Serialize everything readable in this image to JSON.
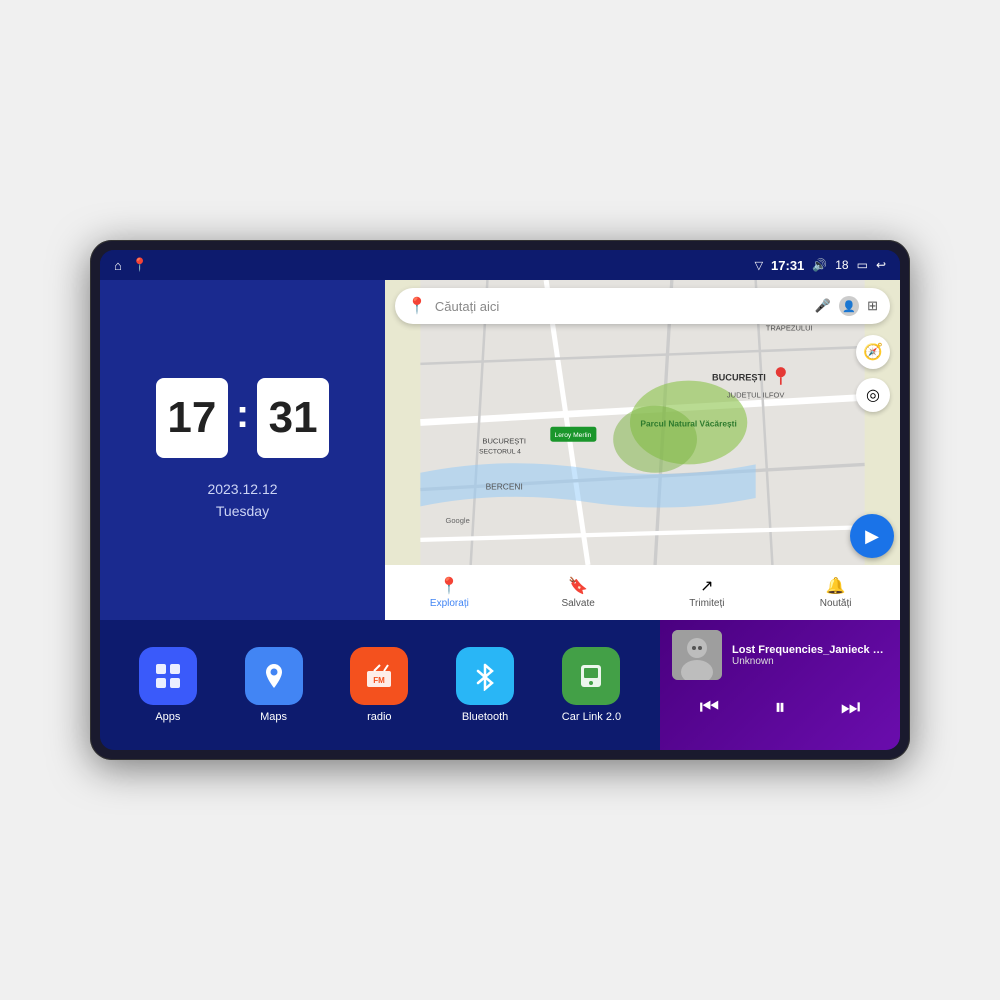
{
  "device": {
    "status_bar": {
      "left_icons": [
        "home",
        "maps"
      ],
      "time": "17:31",
      "signal_icon": "▽",
      "volume_icon": "🔊",
      "volume_level": "18",
      "battery_icon": "▭",
      "back_icon": "↩"
    },
    "clock": {
      "hours": "17",
      "minutes": "31",
      "date": "2023.12.12",
      "day": "Tuesday"
    },
    "map": {
      "search_placeholder": "Căutați aici",
      "location_label": "Parcul Natural Văcărești",
      "area_label": "BUCUREȘTI",
      "subarea_label": "JUDEȚUL ILFOV",
      "district": "TRAPEZULUI",
      "berceni": "BERCENI",
      "nav_items": [
        {
          "label": "Explorați",
          "icon": "📍",
          "active": true
        },
        {
          "label": "Salvate",
          "icon": "🔖",
          "active": false
        },
        {
          "label": "Trimiteți",
          "icon": "↗",
          "active": false
        },
        {
          "label": "Noutăți",
          "icon": "🔔",
          "active": false
        }
      ]
    },
    "apps": [
      {
        "id": "apps",
        "label": "Apps",
        "icon": "⊞",
        "bg": "#3a5afa"
      },
      {
        "id": "maps",
        "label": "Maps",
        "icon": "📍",
        "bg": "#4285f4"
      },
      {
        "id": "radio",
        "label": "radio",
        "icon": "📻",
        "bg": "#f4511e"
      },
      {
        "id": "bluetooth",
        "label": "Bluetooth",
        "icon": "⚡",
        "bg": "#29b6f6"
      },
      {
        "id": "carlink",
        "label": "Car Link 2.0",
        "icon": "📱",
        "bg": "#43a047"
      }
    ],
    "music": {
      "title": "Lost Frequencies_Janieck Devy-...",
      "artist": "Unknown",
      "controls": {
        "prev": "⏮",
        "play_pause": "⏸",
        "next": "⏭"
      }
    }
  }
}
